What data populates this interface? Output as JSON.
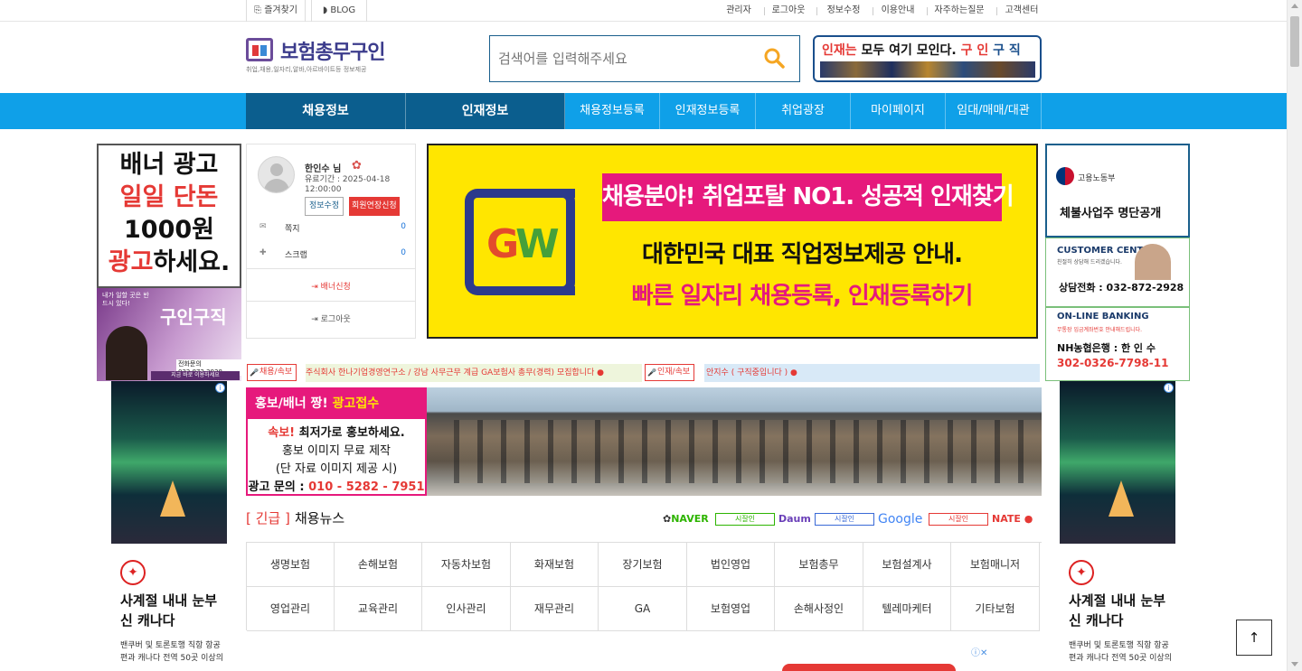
{
  "topbar": {
    "left": [
      {
        "icon": "bookmark-icon",
        "label": "즐겨찾기"
      },
      {
        "icon": "rss-icon",
        "label": "BLOG"
      }
    ],
    "right": [
      "관리자",
      "로그아웃",
      "정보수정",
      "이용안내",
      "자주하는질문",
      "고객센터"
    ]
  },
  "logo": {
    "name": "보험총무구인",
    "tagline": "취업,채용,일자리,알바,아르바이트등 정보제공"
  },
  "search": {
    "placeholder": "검색어를 입력해주세요"
  },
  "top_banner": {
    "text_red": "인재는",
    "text_black": " 모두 여기 모인다.",
    "text_red2": "구 인",
    "text_blue": "구 직"
  },
  "nav": [
    "채용정보",
    "인재정보",
    "채용정보등록",
    "인재정보등록",
    "취업광장",
    "마이페이지",
    "임대/매매/대관"
  ],
  "left_banner": {
    "l1": "배너 광고",
    "l2": "일일 단돈",
    "l3": "1000원",
    "l4a": "광고",
    "l4b": "하세요."
  },
  "left_photo_ad": {
    "small": "내가 일할 곳은 반드시 있다!",
    "big": "구인구직",
    "tel": "전화문의 032.872.2928",
    "foot": "지금 바로 이용하세요"
  },
  "user": {
    "name": "한인수 님",
    "expire": "유료기간 : 2025-04-18 12:00:00",
    "edit_btn": "정보수정",
    "extend_btn": "회원연장신청",
    "rows": [
      {
        "icon": "mail-icon",
        "label": "쪽지",
        "value": "0"
      },
      {
        "icon": "pin-icon",
        "label": "스크랩",
        "value": "0"
      }
    ],
    "banner_apply": "배너신청",
    "logout": "로그아웃"
  },
  "main_ad": {
    "line1": "채용분야! 취업포탈 NO1. 성공적 인재찾기",
    "line2": "대한민국 대표 직업정보제공 안내.",
    "line3": "빠른 일자리 채용등록, 인재등록하기"
  },
  "right_ads": {
    "top_org": "고용노동부",
    "top_title": "체불사업주 명단공개",
    "cc_title": "CUSTOMER CENTER",
    "cc_sub": "친절히 상담해 드리겠습니다.",
    "cc_tel": "상담전화 : 032-872-2928",
    "bank_title": "ON-LINE BANKING",
    "bank_sub": "무통장 입금계좌번호 안내해드립니다.",
    "bank_name": "NH농협은행 : 한 인 수",
    "bank_acct": "302-0326-7798-11"
  },
  "ticker": {
    "label1": "채용/속보",
    "text1": "주식회사 한나기업경영연구소 / 강남 사무근무 계급 GA보험사 총무(경력) 모집합니다 ●",
    "label2": "인재/속보",
    "text2": "안지수 ( 구직중입니다 ) ●"
  },
  "promo": {
    "h1": "홍보/배너 ",
    "h1b": "짱!",
    "h1c": " 광고접수",
    "l1a": "속보!",
    "l1b": " 최저가로 홍보하세요.",
    "l2": "홍보 이미지 무료 제작",
    "l3": "(단 자료 이미지 제공 시)",
    "l4a": "광고 문의 : ",
    "l4b": "010 - 5282 - 7951"
  },
  "google_ad": {
    "headline": "사계절 내내 눈부신 캐나다",
    "desc": "밴쿠버 및 토론토행 직항 항공편과 캐나다 전역 50곳 이상의"
  },
  "news": {
    "tag": "[ 긴급 ]",
    "title": "채용뉴스"
  },
  "portals": [
    {
      "name": "NAVER",
      "btn": "시잘인"
    },
    {
      "name": "Daum",
      "btn": "시잘인"
    },
    {
      "name": "Google",
      "btn": "시잘인"
    },
    {
      "name": "NATE",
      "btn": ""
    }
  ],
  "categories": [
    "생명보험",
    "손해보험",
    "자동차보험",
    "화재보험",
    "장기보험",
    "법인영업",
    "보험총무",
    "보험설계사",
    "보험매니저",
    "영업관리",
    "교육관리",
    "인사관리",
    "재무관리",
    "GA",
    "보험영업",
    "손해사정인",
    "텔레마케터",
    "기타보험"
  ],
  "back_to_top": "↑",
  "colors": {
    "nav": "#0fa0e8",
    "nav_dark": "#0b5e8e",
    "accent_red": "#e53935",
    "pink": "#e6197c",
    "yellow": "#ffe600"
  }
}
